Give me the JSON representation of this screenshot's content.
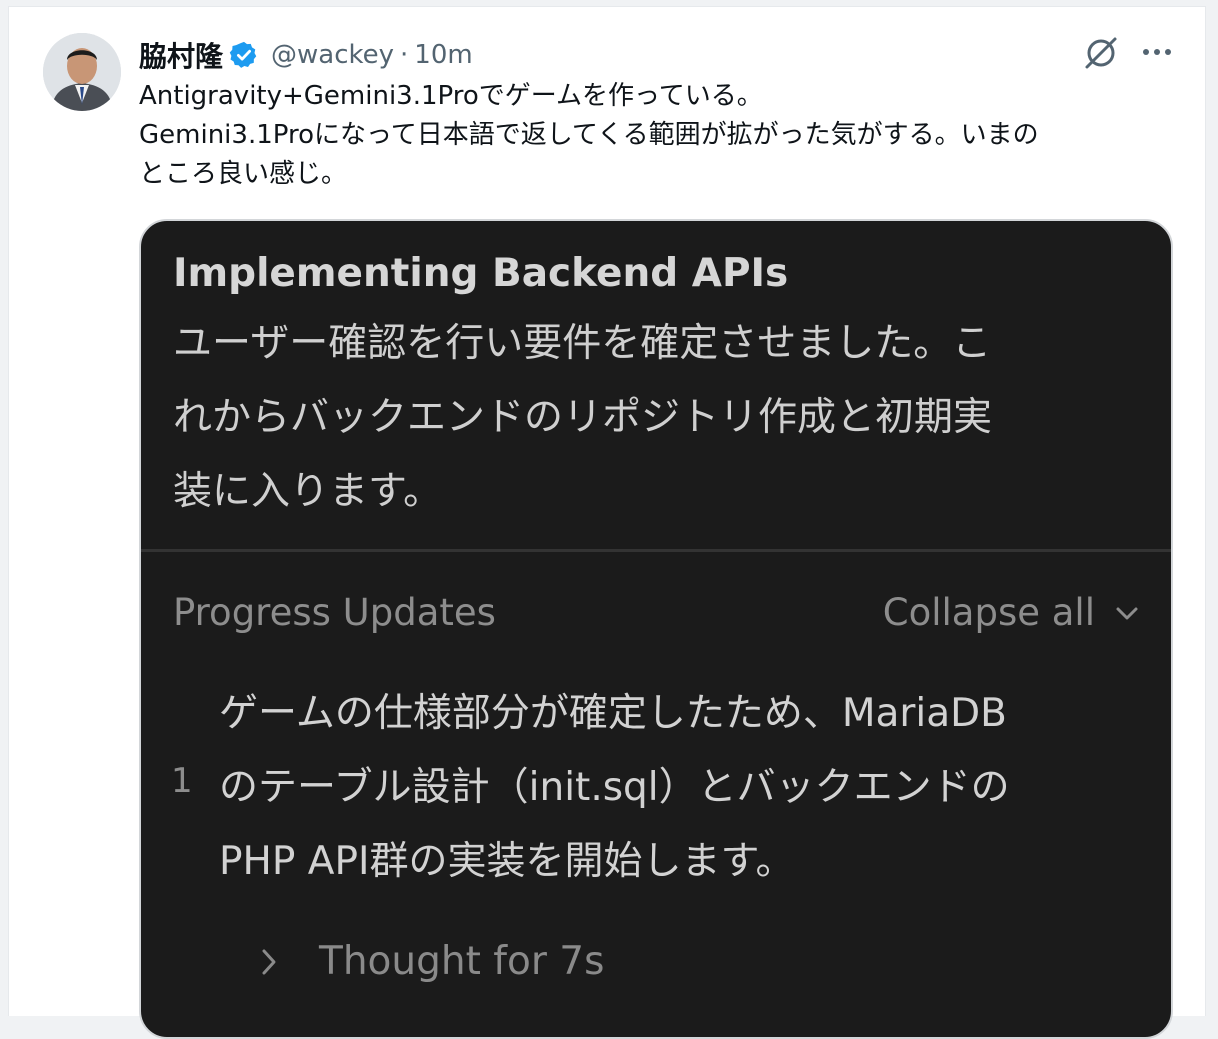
{
  "tweet": {
    "author_name": "脇村隆",
    "handle": "@wackey",
    "separator": "·",
    "time": "10m",
    "text_lines": [
      "Antigravity+Gemini3.1Proでゲームを作っている。",
      "Gemini3.1Proになって日本語で返してくる範囲が拡がった気がする。いまの",
      "ところ良い感じ。"
    ],
    "icons": {
      "verified": "verified-badge-icon",
      "grok": "grok-icon",
      "more": "more-options-icon"
    },
    "colors": {
      "verified_blue": "#1d9bf0",
      "text": "#0f1419",
      "secondary": "#536471"
    }
  },
  "media": {
    "title": "Implementing Backend APIs",
    "summary_lines": [
      "ユーザー確認を行い要件を確定させました。こ",
      "れからバックエンドのリポジトリ作成と初期実",
      "装に入ります。"
    ],
    "progress_label": "Progress Updates",
    "collapse_label": "Collapse all",
    "steps": [
      {
        "number": "1",
        "lines": [
          "ゲームの仕様部分が確定したため、MariaDB",
          "のテーブル設計（init.sql）とバックエンドの",
          "PHP API群の実装を開始します。"
        ]
      }
    ],
    "thought_label": "Thought for 7s",
    "colors": {
      "background": "#1b1b1b"
    }
  }
}
